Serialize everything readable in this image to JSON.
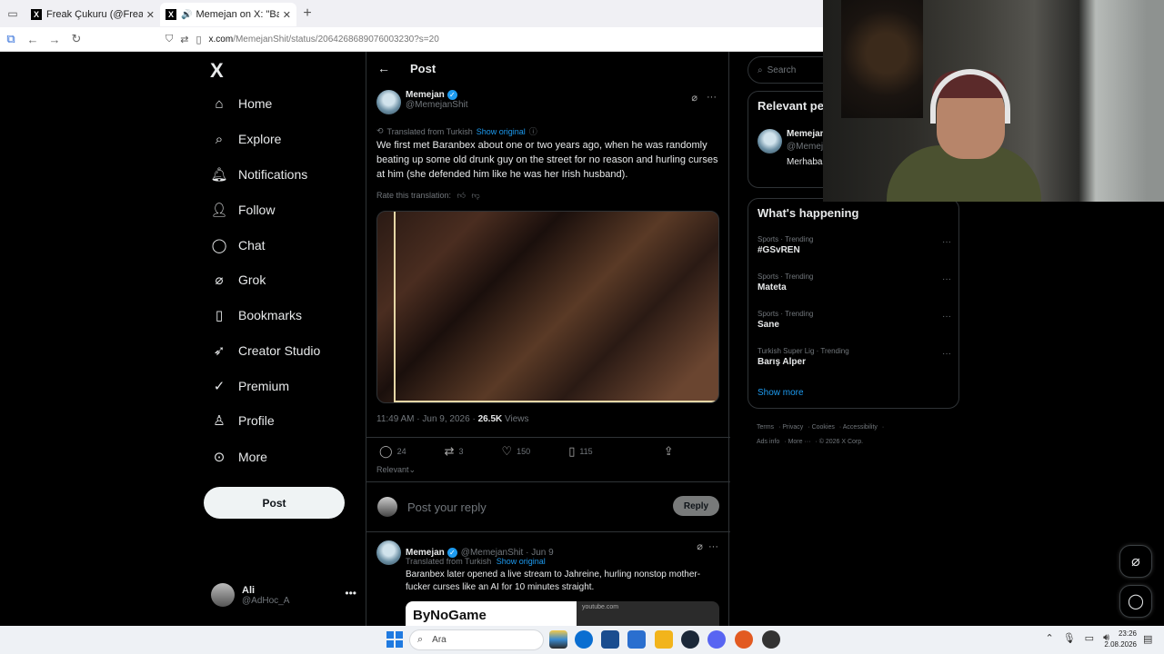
{
  "browser": {
    "tabs": [
      {
        "title": "Freak Çukuru (@FreakCukuruX)",
        "active": false
      },
      {
        "title": "Memejan on X: \"Baranbex l",
        "active": true
      }
    ],
    "url_domain": "x.com",
    "url_path": "/MemejanShit/status/2064268689076003230?s=20"
  },
  "nav": {
    "logo": "X",
    "items": [
      {
        "label": "Home",
        "icon": "home-icon"
      },
      {
        "label": "Explore",
        "icon": "search-icon"
      },
      {
        "label": "Notifications",
        "icon": "bell-icon"
      },
      {
        "label": "Follow",
        "icon": "follow-icon"
      },
      {
        "label": "Chat",
        "icon": "chat-icon"
      },
      {
        "label": "Grok",
        "icon": "grok-icon"
      },
      {
        "label": "Bookmarks",
        "icon": "bookmark-icon"
      },
      {
        "label": "Creator Studio",
        "icon": "rocket-icon"
      },
      {
        "label": "Premium",
        "icon": "premium-icon"
      },
      {
        "label": "Profile",
        "icon": "person-icon"
      },
      {
        "label": "More",
        "icon": "more-icon"
      }
    ],
    "post_button": "Post",
    "account": {
      "name": "Ali",
      "handle": "@AdHoc_A"
    }
  },
  "main": {
    "header_title": "Post",
    "tweet": {
      "name": "Memejan",
      "handle": "@MemejanShit",
      "translated_from": "Translated from Turkish",
      "show_original": "Show original",
      "text": "We first met Baranbex about one or two years ago, when he was randomly beating up some old drunk guy on the street for no reason and hurling curses at him (she defended him like he was her Irish husband).",
      "rate_translation": "Rate this translation:",
      "time": "11:49 AM · Jun 9, 2026 · ",
      "views_count": "26.5K",
      "views_label": " Views",
      "replies": "24",
      "reposts": "3",
      "likes": "150",
      "bookmarks": "115"
    },
    "relevant_label": "Relevant",
    "reply_placeholder": "Post your reply",
    "reply_button": "Reply",
    "reply_tweet": {
      "name": "Memejan",
      "handle": "@MemejanShit · Jun 9",
      "translated_from": "Translated from Turkish",
      "show_original": "Show original",
      "text": "Baranbex later opened a live stream to Jahreine, hurling nonstop mother-fucker curses like an AI for 10 minutes straight.",
      "media_brand": "ByNoGame",
      "media_source": "youtube.com"
    }
  },
  "right": {
    "search_placeholder": "Search",
    "relevant_people": {
      "title": "Relevant people",
      "name": "Memejan",
      "handle": "@MemejanShit",
      "bio": "Merhaba, memeler üretiyorum."
    },
    "happening_title": "What's happening",
    "trends": [
      {
        "context": "Sports · Trending",
        "title": "#GSvREN"
      },
      {
        "context": "Sports · Trending",
        "title": "Mateta"
      },
      {
        "context": "Sports · Trending",
        "title": "Sane"
      },
      {
        "context": "Turkish Super Lig · Trending",
        "title": "Barış Alper"
      }
    ],
    "show_more": "Show more",
    "footer": [
      "Terms",
      "Privacy",
      "Cookies",
      "Accessibility",
      "Ads info",
      "More ···",
      "© 2026 X Corp."
    ]
  },
  "taskbar": {
    "search_label": "Ara",
    "time": "23:26",
    "date": "2.08.2026"
  }
}
